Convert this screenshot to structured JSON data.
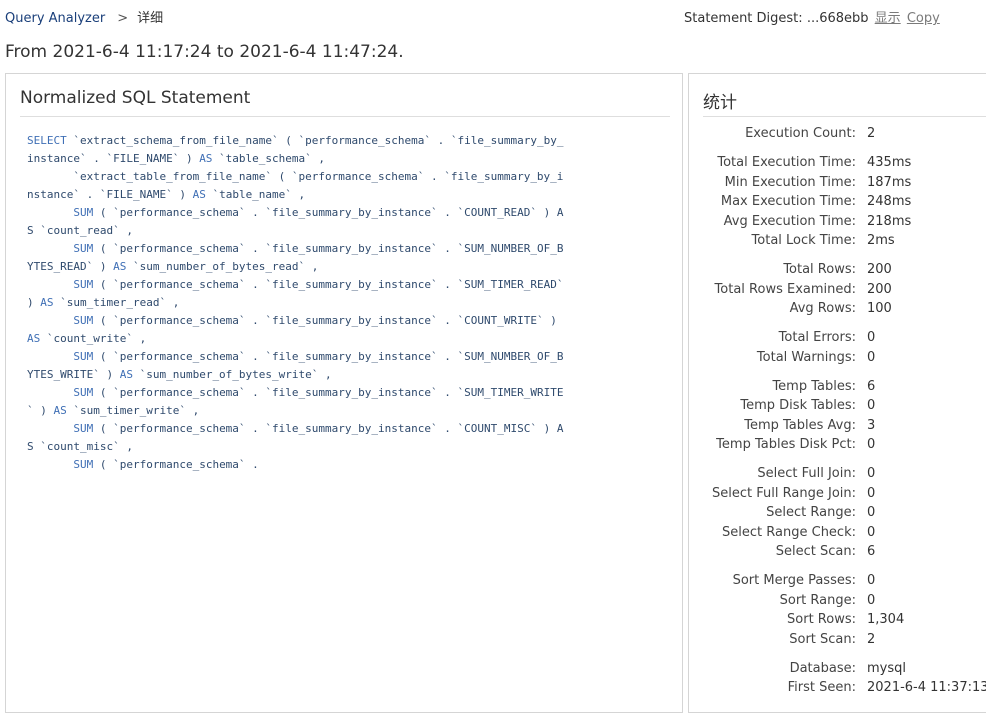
{
  "breadcrumb": {
    "home": "Query Analyzer",
    "separator": ">",
    "current": "详细"
  },
  "digest": {
    "label": "Statement Digest:",
    "value": "...668ebb",
    "show": "显示",
    "copy": "Copy"
  },
  "time_range": "From 2021-6-4 11:17:24 to 2021-6-4 11:47:24.",
  "sql_panel": {
    "title": "Normalized SQL Statement",
    "lines": [
      "SELECT `extract_schema_from_file_name` ( `performance_schema` . `file_summary_by_",
      "instance` . `FILE_NAME` ) AS `table_schema` ,",
      "       `extract_table_from_file_name` ( `performance_schema` . `file_summary_by_i",
      "nstance` . `FILE_NAME` ) AS `table_name` ,",
      "       SUM ( `performance_schema` . `file_summary_by_instance` . `COUNT_READ` ) A",
      "S `count_read` ,",
      "       SUM ( `performance_schema` . `file_summary_by_instance` . `SUM_NUMBER_OF_B",
      "YTES_READ` ) AS `sum_number_of_bytes_read` ,",
      "       SUM ( `performance_schema` . `file_summary_by_instance` . `SUM_TIMER_READ`",
      ") AS `sum_timer_read` ,",
      "       SUM ( `performance_schema` . `file_summary_by_instance` . `COUNT_WRITE` )",
      "AS `count_write` ,",
      "       SUM ( `performance_schema` . `file_summary_by_instance` . `SUM_NUMBER_OF_B",
      "YTES_WRITE` ) AS `sum_number_of_bytes_write` ,",
      "       SUM ( `performance_schema` . `file_summary_by_instance` . `SUM_TIMER_WRITE",
      "` ) AS `sum_timer_write` ,",
      "       SUM ( `performance_schema` . `file_summary_by_instance` . `COUNT_MISC` ) A",
      "S `count_misc` ,",
      "       SUM ( `performance_schema` ."
    ]
  },
  "stats_panel": {
    "title": "统计",
    "groups": [
      [
        {
          "label": "Execution Count:",
          "value": "2"
        }
      ],
      [
        {
          "label": "Total Execution Time:",
          "value": "435ms"
        },
        {
          "label": "Min Execution Time:",
          "value": "187ms"
        },
        {
          "label": "Max Execution Time:",
          "value": "248ms"
        },
        {
          "label": "Avg Execution Time:",
          "value": "218ms"
        },
        {
          "label": "Total Lock Time:",
          "value": "2ms"
        }
      ],
      [
        {
          "label": "Total Rows:",
          "value": "200"
        },
        {
          "label": "Total Rows Examined:",
          "value": "200"
        },
        {
          "label": "Avg Rows:",
          "value": "100"
        }
      ],
      [
        {
          "label": "Total Errors:",
          "value": "0"
        },
        {
          "label": "Total Warnings:",
          "value": "0"
        }
      ],
      [
        {
          "label": "Temp Tables:",
          "value": "6"
        },
        {
          "label": "Temp Disk Tables:",
          "value": "0"
        },
        {
          "label": "Temp Tables Avg:",
          "value": "3"
        },
        {
          "label": "Temp Tables Disk Pct:",
          "value": "0"
        }
      ],
      [
        {
          "label": "Select Full Join:",
          "value": "0"
        },
        {
          "label": "Select Full Range Join:",
          "value": "0"
        },
        {
          "label": "Select Range:",
          "value": "0"
        },
        {
          "label": "Select Range Check:",
          "value": "0"
        },
        {
          "label": "Select Scan:",
          "value": "6"
        }
      ],
      [
        {
          "label": "Sort Merge Passes:",
          "value": "0"
        },
        {
          "label": "Sort Range:",
          "value": "0"
        },
        {
          "label": "Sort Rows:",
          "value": "1,304"
        },
        {
          "label": "Sort Scan:",
          "value": "2"
        }
      ],
      [
        {
          "label": "Database:",
          "value": "mysql"
        },
        {
          "label": "First Seen:",
          "value": "2021-6-4 11:37:13"
        }
      ]
    ]
  }
}
